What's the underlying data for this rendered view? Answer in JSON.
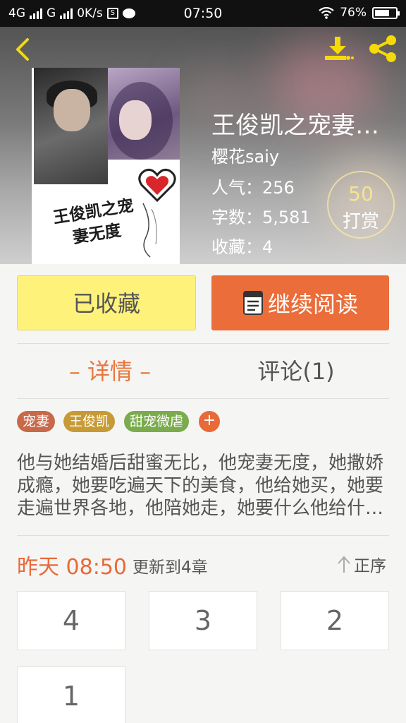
{
  "status_bar": {
    "network_1": "4G",
    "network_2": "G",
    "speed": "0K/s",
    "sim_badge": "S",
    "time": "07:50",
    "battery": "76%",
    "battery_level": 0.76
  },
  "header": {
    "back_icon": "chevron-left-icon",
    "download_icon": "download-icon",
    "share_icon": "share-icon",
    "icon_color": "#f4d90b"
  },
  "cover": {
    "title_line_1": "王俊凯之宠",
    "title_line_2": "妻无度"
  },
  "book": {
    "title": "王俊凯之宠妻…",
    "author": "樱花saiy",
    "popularity": "人气：256",
    "word_count": "字数：5,581",
    "favorites": "收藏：4"
  },
  "tip": {
    "count": "50",
    "label": "打赏"
  },
  "actions": {
    "favorited_label": "已收藏",
    "continue_label": "继续阅读",
    "favorited_color": "#fef27a",
    "continue_color": "#ea6d3a"
  },
  "tabs": {
    "details": "– 详情 –",
    "comments": "评论(1)",
    "active_color": "#e8773f"
  },
  "tags": [
    {
      "label": "宠妻",
      "color": "#c8694a"
    },
    {
      "label": "王俊凯",
      "color": "#c79a35"
    },
    {
      "label": "甜宠微虐",
      "color": "#7aab4c"
    }
  ],
  "tag_add": "+",
  "synopsis": "他与她结婚后甜蜜无比，他宠妻无度，她撒娇成瘾，她要吃遍天下的美食，他给她买，她要走遍世界各地，他陪她走，她要什么他给什么，他宠她入骨。",
  "update": {
    "time": "昨天 08:50",
    "text": "更新到4章",
    "sort_label": "正序"
  },
  "chapters": [
    "4",
    "3",
    "2",
    "1"
  ]
}
